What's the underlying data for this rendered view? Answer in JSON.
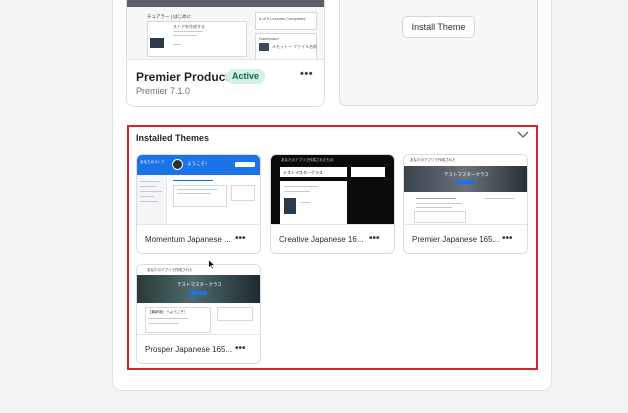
{
  "active_theme": {
    "name": "Premier Product",
    "badge": "Active",
    "version": "Premier 7.1.0",
    "preview_heading": "チュアラー | はじめに",
    "preview_line": "ストアを作成する",
    "preview_side": "5 of 5 Lessons Completed",
    "preview_side2": "Dashboard",
    "preview_item": "ルモットー ファイル名前"
  },
  "install_theme": {
    "button_label": "Install Theme"
  },
  "installed": {
    "title": "Installed Themes",
    "themes": [
      {
        "name": "Momentum Japanese ...",
        "thumb_heading": "ようこそ！",
        "thumb_side": "あなたのストア"
      },
      {
        "name": "Creative Japanese 16...",
        "thumb_heading": "あなたのアプリで作成されたもの",
        "thumb_text": "テストマスタークラス"
      },
      {
        "name": "Premier Japanese 165...",
        "thumb_heading": "あなたのアプリで作成された",
        "thumb_banner": "テストマスタークラス"
      },
      {
        "name": "Prosper Japanese 165...",
        "thumb_heading": "あなたのアプリで作成された",
        "thumb_banner": "テストマスタークラス",
        "thumb_sub": "【最新版】 へようこそ！"
      }
    ]
  },
  "colors": {
    "highlight": "#d4252f",
    "active_badge_bg": "#d3f1e4",
    "active_badge_text": "#0b6b48",
    "momentum_accent": "#1a73e8"
  },
  "icons": [
    "more-horizontal-icon",
    "chevron-down-icon",
    "mouse-cursor-icon"
  ]
}
